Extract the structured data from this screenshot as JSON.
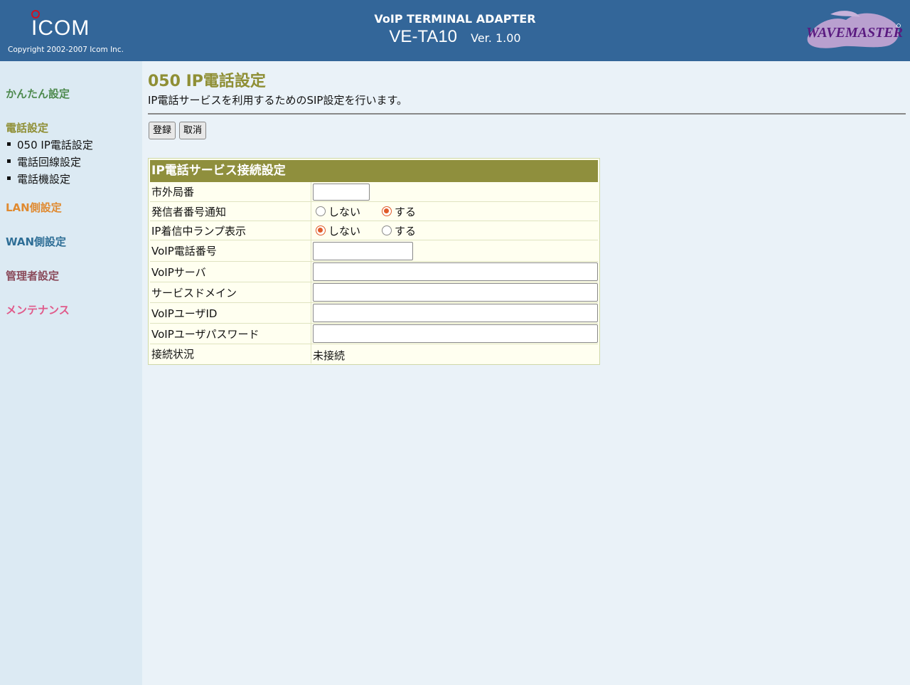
{
  "header": {
    "logo_text": "ICOM",
    "copyright": "Copyright 2002-2007 Icom Inc.",
    "product_type": "VoIP TERMINAL ADAPTER",
    "model": "VE-TA10",
    "version": "Ver. 1.00",
    "brand_logo_text": "WAVEMASTER",
    "brand_color": "#336699"
  },
  "sidebar": {
    "sections": [
      {
        "label": "かんたん設定",
        "color": "#4e8a4e"
      },
      {
        "label": "電話設定",
        "color": "#8f8f35"
      },
      {
        "label": "LAN側設定",
        "color": "#e08a30"
      },
      {
        "label": "WAN側設定",
        "color": "#2e6e96"
      },
      {
        "label": "管理者設定",
        "color": "#8a4a5a"
      },
      {
        "label": "メンテナンス",
        "color": "#e05a8a"
      }
    ],
    "sub_items": [
      {
        "label": "050 IP電話設定"
      },
      {
        "label": "電話回線設定"
      },
      {
        "label": "電話機設定"
      }
    ]
  },
  "main": {
    "title": "050 IP電話設定",
    "description": "IP電話サービスを利用するためのSIP設定を行います。",
    "buttons": {
      "register": "登録",
      "cancel": "取消"
    },
    "table": {
      "header": "IP電話サービス接続設定",
      "rows": [
        {
          "label": "市外局番",
          "value": ""
        },
        {
          "label": "発信者番号通知",
          "options": [
            "しない",
            "する"
          ],
          "selected": "する"
        },
        {
          "label": "IP着信中ランプ表示",
          "options": [
            "しない",
            "する"
          ],
          "selected": "しない"
        },
        {
          "label": "VoIP電話番号",
          "value": ""
        },
        {
          "label": "VoIPサーバ",
          "value": ""
        },
        {
          "label": "サービスドメイン",
          "value": ""
        },
        {
          "label": "VoIPユーザID",
          "value": ""
        },
        {
          "label": "VoIPユーザパスワード",
          "value": ""
        },
        {
          "label": "接続状況",
          "value": "未接続"
        }
      ]
    }
  }
}
